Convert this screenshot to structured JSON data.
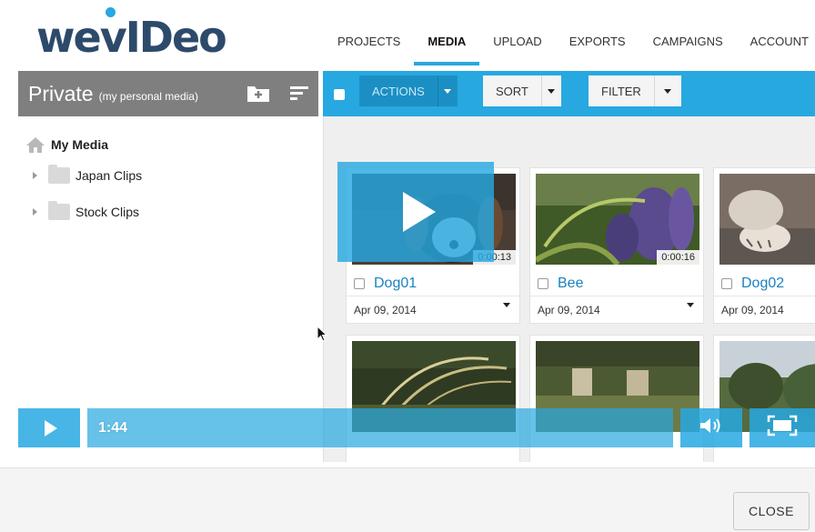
{
  "logo": {
    "text_we": "we",
    "text_rest": "vIDeo"
  },
  "nav": [
    {
      "label": "PROJECTS",
      "active": false
    },
    {
      "label": "MEDIA",
      "active": true
    },
    {
      "label": "UPLOAD",
      "active": false
    },
    {
      "label": "EXPORTS",
      "active": false
    },
    {
      "label": "CAMPAIGNS",
      "active": false
    },
    {
      "label": "ACCOUNT",
      "active": false
    }
  ],
  "sidebar": {
    "title": "Private",
    "subtitle": "(my personal media)",
    "root_label": "My Media",
    "folders": [
      {
        "label": "Japan Clips"
      },
      {
        "label": "Stock Clips"
      }
    ]
  },
  "toolbar": {
    "actions_label": "ACTIONS",
    "sort_label": "SORT",
    "filter_label": "FILTER"
  },
  "media": [
    {
      "title": "Dog01",
      "date": "Apr 09, 2014",
      "duration": "0:00:13"
    },
    {
      "title": "Bee",
      "date": "Apr 09, 2014",
      "duration": "0:00:16"
    },
    {
      "title": "Dog02",
      "date": "Apr 09, 2014",
      "duration": ""
    }
  ],
  "player": {
    "time": "1:44",
    "progress": 1.0
  },
  "footer": {
    "close_label": "CLOSE"
  },
  "colors": {
    "accent": "#27a8e0",
    "sidebar_header": "#7f7f7f",
    "logo": "#2d4a6b",
    "link": "#1a82c0"
  }
}
